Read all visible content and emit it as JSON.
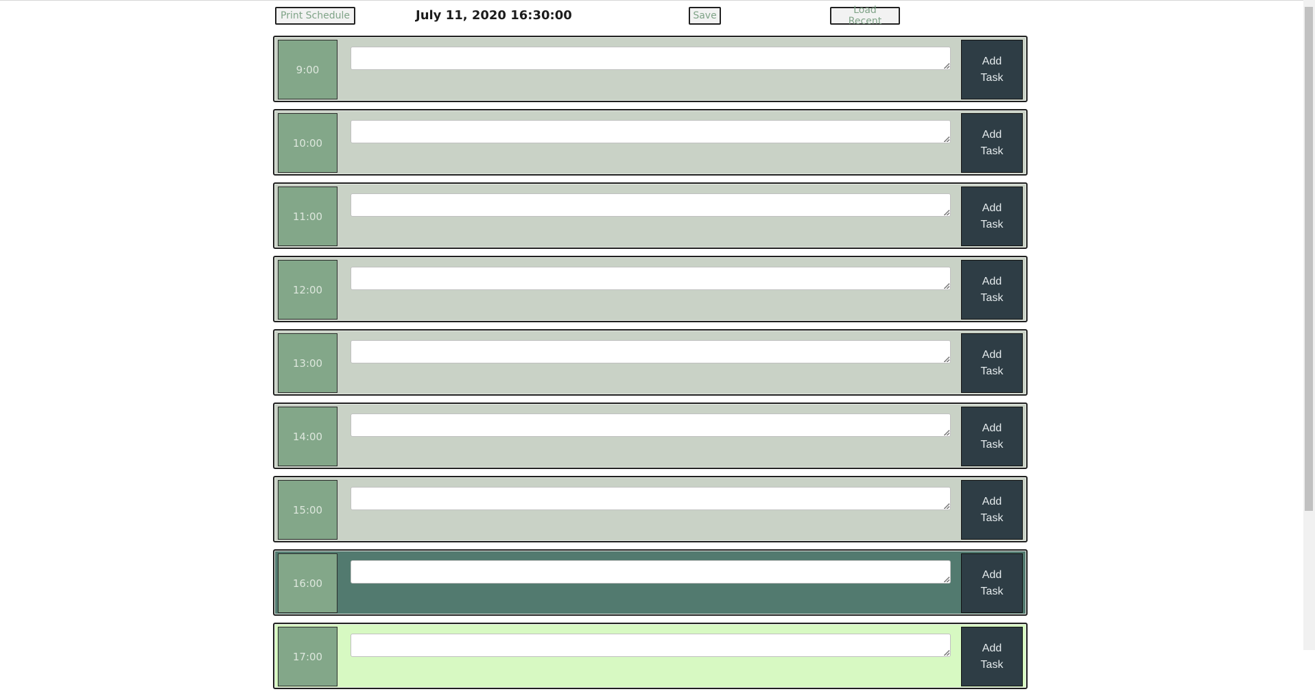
{
  "header": {
    "print_label": "Print Schedule",
    "datetime": "July 11, 2020 16:30:00",
    "save_label": "Save",
    "load_label": "Load Recent"
  },
  "rows": [
    {
      "hour": "9:00",
      "state": "past",
      "button": "Add Task",
      "task": ""
    },
    {
      "hour": "10:00",
      "state": "past",
      "button": "Add Task",
      "task": ""
    },
    {
      "hour": "11:00",
      "state": "past",
      "button": "Add Task",
      "task": ""
    },
    {
      "hour": "12:00",
      "state": "past",
      "button": "Add Task",
      "task": ""
    },
    {
      "hour": "13:00",
      "state": "past",
      "button": "Add Task",
      "task": ""
    },
    {
      "hour": "14:00",
      "state": "past",
      "button": "Add Task",
      "task": ""
    },
    {
      "hour": "15:00",
      "state": "past",
      "button": "Add Task",
      "task": ""
    },
    {
      "hour": "16:00",
      "state": "present",
      "button": "Add Task",
      "task": ""
    },
    {
      "hour": "17:00",
      "state": "future",
      "button": "Add Task",
      "task": ""
    }
  ],
  "colors": {
    "past": "#c9d2c6",
    "present": "#527a6f",
    "future": "#d7f9c2",
    "hour_block": "#83a789",
    "add_button": "#2e3d45"
  }
}
